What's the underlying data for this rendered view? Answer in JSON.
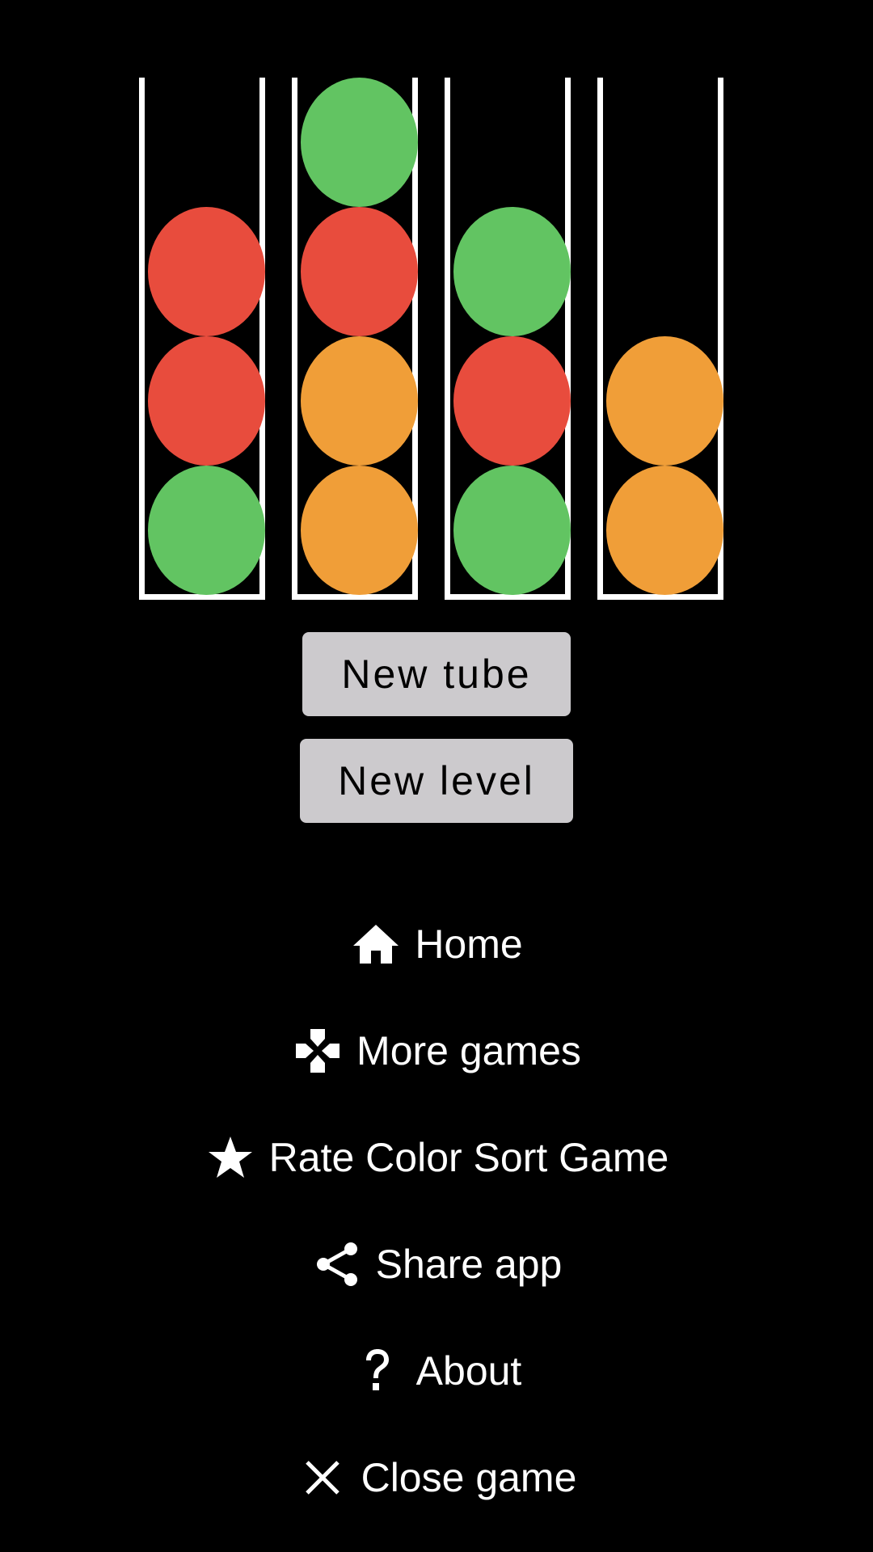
{
  "board": {
    "tubes": [
      {
        "balls": [
          "red",
          "red",
          "green"
        ]
      },
      {
        "balls": [
          "green",
          "red",
          "orange",
          "orange"
        ]
      },
      {
        "balls": [
          "green",
          "red",
          "green"
        ]
      },
      {
        "balls": [
          "orange",
          "orange"
        ]
      }
    ],
    "colors": {
      "red": "#e84c3d",
      "green": "#62c462",
      "orange": "#f09e38",
      "tube_border": "#ffffff",
      "button_bg": "#cccacd",
      "background": "#000000"
    }
  },
  "buttons": {
    "new_tube": "New tube",
    "new_level": "New level"
  },
  "menu": {
    "home": {
      "label": "Home",
      "icon": "home-icon"
    },
    "more_games": {
      "label": "More games",
      "icon": "gamepad-icon"
    },
    "rate": {
      "label": "Rate Color Sort Game",
      "icon": "star-icon"
    },
    "share": {
      "label": "Share app",
      "icon": "share-icon"
    },
    "about": {
      "label": "About",
      "icon": "question-icon"
    },
    "close": {
      "label": "Close game",
      "icon": "close-icon"
    }
  }
}
